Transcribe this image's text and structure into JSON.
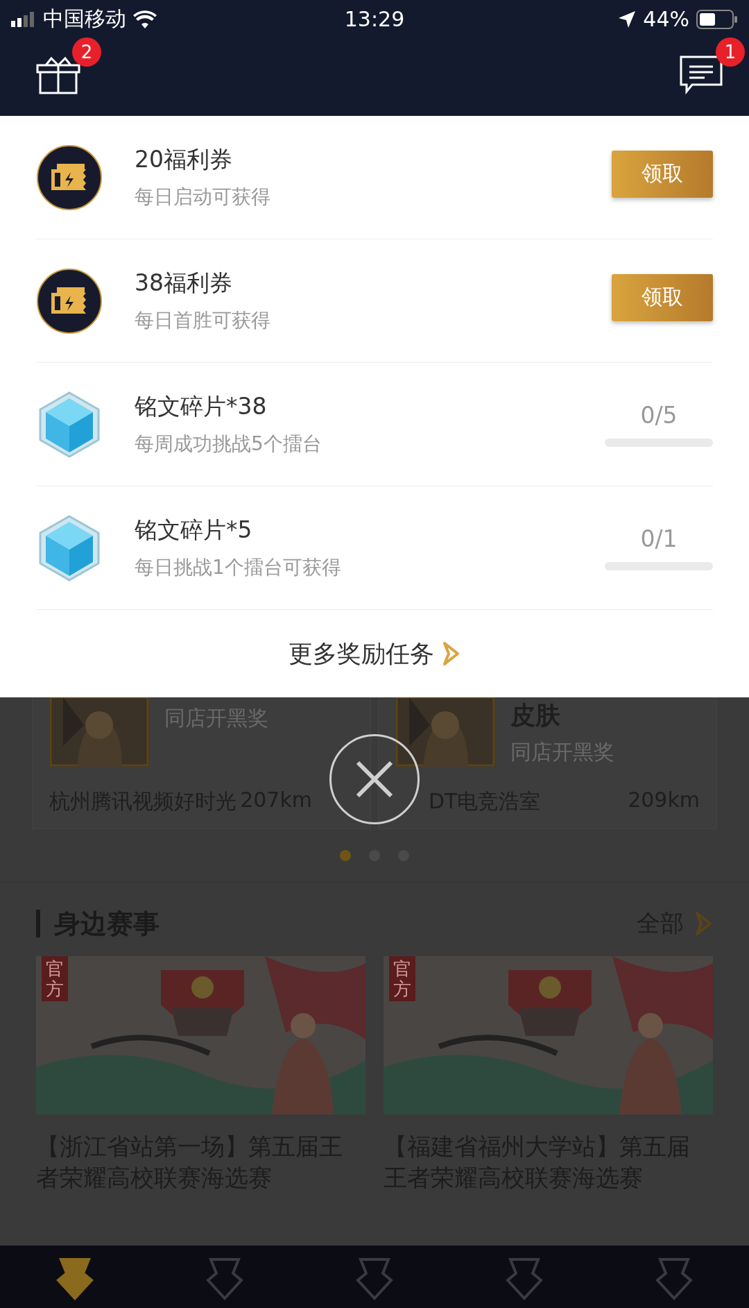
{
  "status_bar": {
    "carrier": "中国移动",
    "time": "13:29",
    "battery": "44%"
  },
  "header": {
    "gift_badge": "2",
    "message_badge": "1"
  },
  "rewards": [
    {
      "kind": "claim",
      "title": "20福利券",
      "subtitle": "每日启动可获得",
      "button": "领取"
    },
    {
      "kind": "claim",
      "title": "38福利券",
      "subtitle": "每日首胜可获得",
      "button": "领取"
    },
    {
      "kind": "progress",
      "title": "铭文碎片*38",
      "subtitle": "每周成功挑战5个擂台",
      "reading": "0/5",
      "level": 0
    },
    {
      "kind": "progress",
      "title": "铭文碎片*5",
      "subtitle": "每日挑战1个擂台可获得",
      "reading": "0/1",
      "level": 0
    }
  ],
  "more_link": "更多奖励任务",
  "shop_cards": [
    {
      "subtitle": "同店开黑奖",
      "name": "杭州腾讯视频好时光",
      "distance": "207km"
    },
    {
      "heading": "皮肤",
      "subtitle": "同店开黑奖",
      "name": "DT电竞浩室",
      "distance": "209km"
    }
  ],
  "carousel_dots": [
    {
      "selected": true
    },
    {
      "selected": false
    },
    {
      "selected": false
    }
  ],
  "section": {
    "title": "身边赛事",
    "all_link": "全部"
  },
  "events": [
    {
      "tag": "官方",
      "title": "【浙江省站第一场】第五届王者荣耀高校联赛海选赛"
    },
    {
      "tag": "官方",
      "title": "【福建省福州大学站】第五届王者荣耀高校联赛海选赛"
    }
  ],
  "tab_bar": [
    {
      "selected": true
    },
    {
      "selected": false
    },
    {
      "selected": false
    },
    {
      "selected": false
    },
    {
      "selected": false
    }
  ]
}
